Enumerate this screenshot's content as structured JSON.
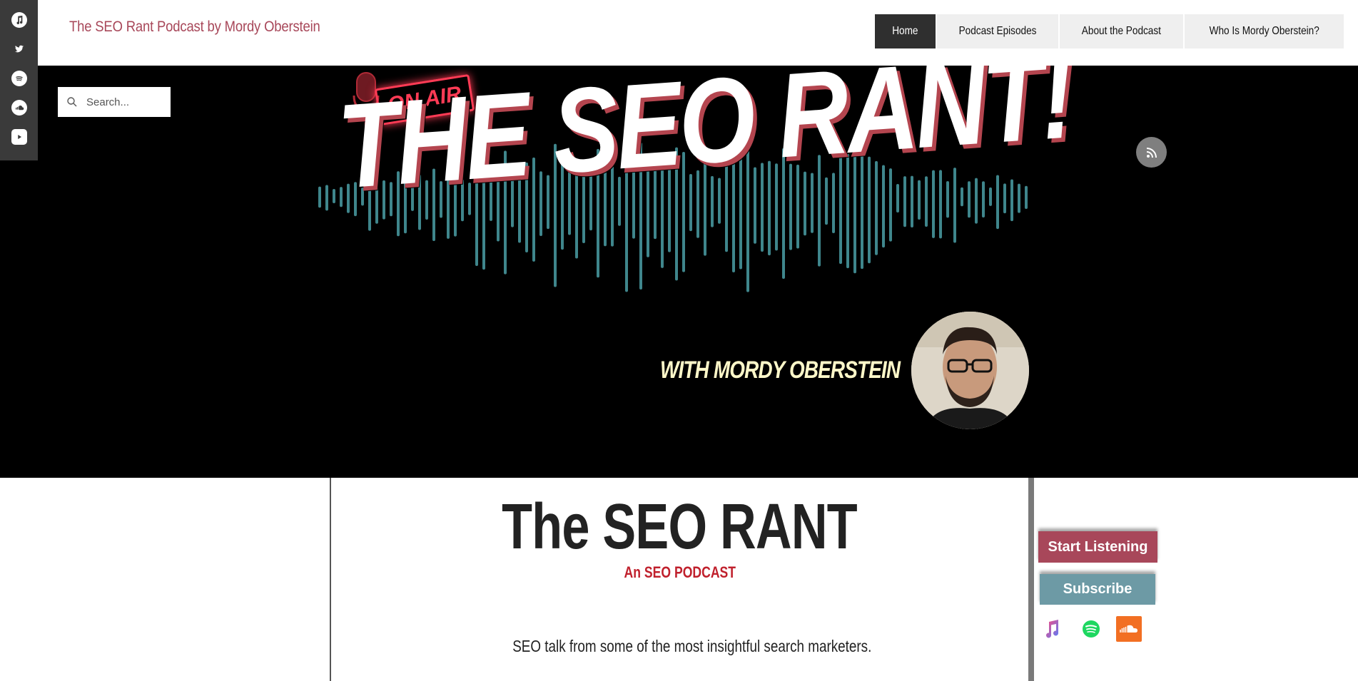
{
  "colors": {
    "accent": "#a8485a",
    "nav_active": "#2f2f2f",
    "hero_bg": "#000000",
    "start_listening": "#a8475a",
    "subscribe": "#6d9aa5",
    "subtitle": "#c0202c",
    "waveform": "#4a9da4"
  },
  "social": [
    {
      "name": "music-icon"
    },
    {
      "name": "twitter-icon"
    },
    {
      "name": "spotify-icon"
    },
    {
      "name": "soundcloud-icon"
    },
    {
      "name": "youtube-icon"
    }
  ],
  "header": {
    "site_title": "The SEO Rant Podcast by Mordy Oberstein"
  },
  "nav": {
    "items": [
      {
        "label": "Home",
        "active": true
      },
      {
        "label": "Podcast Episodes",
        "active": false
      },
      {
        "label": "About the Podcast",
        "active": false
      },
      {
        "label": "Who Is Mordy Oberstein?",
        "active": false
      }
    ]
  },
  "search": {
    "placeholder": "Search..."
  },
  "hero": {
    "on_air": "ON AIR",
    "logo": "THE SEO RANT!",
    "with_line": "WITH MORDY OBERSTEIN",
    "rss_icon": "rss-icon"
  },
  "main": {
    "title": "The SEO RANT",
    "subtitle": "An SEO PODCAST",
    "tagline": "SEO talk from some of the most insightful search marketers."
  },
  "side": {
    "start_listening": "Start Listening",
    "subscribe": "Subscribe",
    "platforms": [
      "apple-music-icon",
      "spotify-icon",
      "soundcloud-icon"
    ]
  }
}
